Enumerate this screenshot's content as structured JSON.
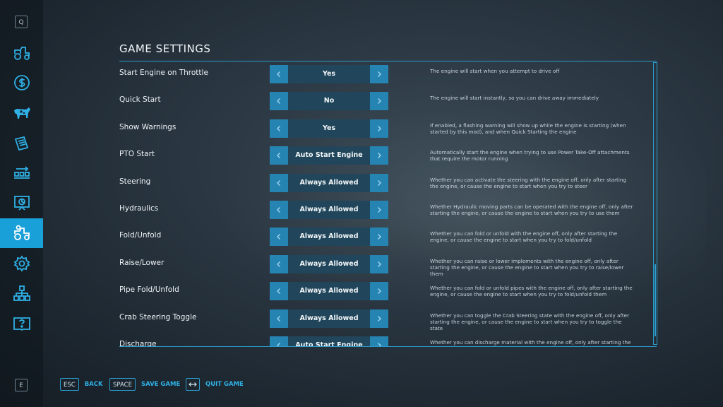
{
  "sidebar": {
    "top_key": "Q",
    "bottom_key": "E"
  },
  "page": {
    "title": "GAME SETTINGS"
  },
  "settings": [
    {
      "label": "Start Engine on Throttle",
      "value": "Yes",
      "desc": "The engine will start when you attempt to drive off"
    },
    {
      "label": "Quick Start",
      "value": "No",
      "desc": "The engine will start instantly, so you can drive away immediately"
    },
    {
      "label": "Show Warnings",
      "value": "Yes",
      "desc": "If enabled, a flashing warning will show up while the engine is starting (when started by this mod), and when Quick Starting the engine"
    },
    {
      "label": "PTO Start",
      "value": "Auto Start Engine",
      "desc": "Automatically start the engine when trying to use Power Take-Off attachments that require the motor running"
    },
    {
      "label": "Steering",
      "value": "Always Allowed",
      "desc": "Whether you can activate the steering with the engine off, only after starting the engine, or cause the engine to start when you try to steer"
    },
    {
      "label": "Hydraulics",
      "value": "Always Allowed",
      "desc": "Whether Hydraulic moving parts can be operated with the engine off, only after starting the engine, or cause the engine to start when you try to use them"
    },
    {
      "label": "Fold/Unfold",
      "value": "Always Allowed",
      "desc": "Whether you can fold or unfold with the engine off, only after starting the engine, or cause the engine to start when you try to fold/unfold"
    },
    {
      "label": "Raise/Lower",
      "value": "Always Allowed",
      "desc": "Whether you can raise or lower implements with the engine off, only after starting the engine, or cause the engine to start when you try to raise/lower them"
    },
    {
      "label": "Pipe Fold/Unfold",
      "value": "Always Allowed",
      "desc": "Whether you can fold or unfold pipes with the engine off, only after starting the engine, or cause the engine to start when you try to fold/unfold them"
    },
    {
      "label": "Crab Steering Toggle",
      "value": "Always Allowed",
      "desc": "Whether you can toggle the Crab Steering state with the engine off, only after starting the engine, or cause the engine to start when you try to toggle the state"
    },
    {
      "label": "Discharge",
      "value": "Auto Start Engine",
      "desc": "Whether you can discharge material with the engine off, only after starting the"
    }
  ],
  "footer": {
    "back_key": "ESC",
    "back_label": "BACK",
    "save_key": "SPACE",
    "save_label": "SAVE GAME",
    "quit_label": "QUIT GAME"
  },
  "colors": {
    "accent": "#1aa0d8",
    "arrow": "#2684b3",
    "value_bg": "#21465b"
  }
}
